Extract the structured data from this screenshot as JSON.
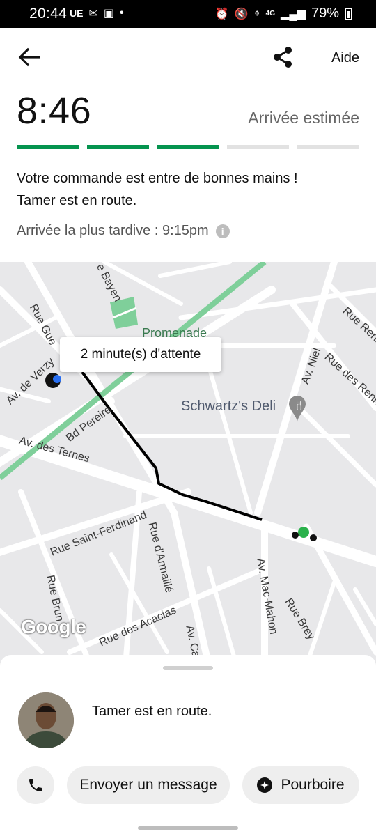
{
  "status_bar": {
    "time": "20:44",
    "left_icons": [
      "UE",
      "gmail-icon",
      "app-icon",
      "dot-icon"
    ],
    "right_icons": [
      "alarm-icon",
      "mute-icon",
      "location-icon",
      "4g-icon",
      "signal-icon"
    ],
    "network": "4G",
    "battery": "79%"
  },
  "header": {
    "back_icon": "arrow-left-icon",
    "share_icon": "share-icon",
    "help_label": "Aide"
  },
  "eta": {
    "time": "8:46",
    "label": "Arrivée estimée",
    "progress_segments_total": 5,
    "progress_segments_done": 3,
    "progress_color": "#05944f"
  },
  "message": {
    "line1": "Votre commande est entre de bonnes mains !",
    "line2": "Tamer est en route."
  },
  "latest_arrival": {
    "text": "Arrivée la plus tardive : 9:15pm",
    "info_icon": "info-icon"
  },
  "map": {
    "tooltip": "2 minute(s) d'attente",
    "poi": "Schwartz's Deli",
    "poi_icon": "restaurant-pin-icon",
    "streets": {
      "bayen": "e Bayen",
      "promenade": "Promenade",
      "guer": "Rue Gue",
      "verzy": "Av. de Verzy",
      "pereire": "Bd Pereire",
      "ternes": "Av. des Ternes",
      "saint_ferdinand": "Rue Saint-Ferdinand",
      "armaille": "Rue d'Armaillé",
      "brun": "Rue Brun",
      "acacias": "Rue des Acacias",
      "carr": "Av. Carr",
      "mac_mahon": "Av. Mac-Mahon",
      "brey": "Rue Brey",
      "niel": "Av. Niel",
      "renn": "Rue des Renn",
      "renn2": "Rue Renn"
    },
    "attribution": "Google",
    "route_color": "#000000",
    "park_color": "#7fcf9a"
  },
  "driver": {
    "status": "Tamer est en route."
  },
  "actions": {
    "call_icon": "phone-icon",
    "message_label": "Envoyer un message",
    "tip_label": "Pourboire",
    "tip_icon": "tip-star-icon"
  }
}
